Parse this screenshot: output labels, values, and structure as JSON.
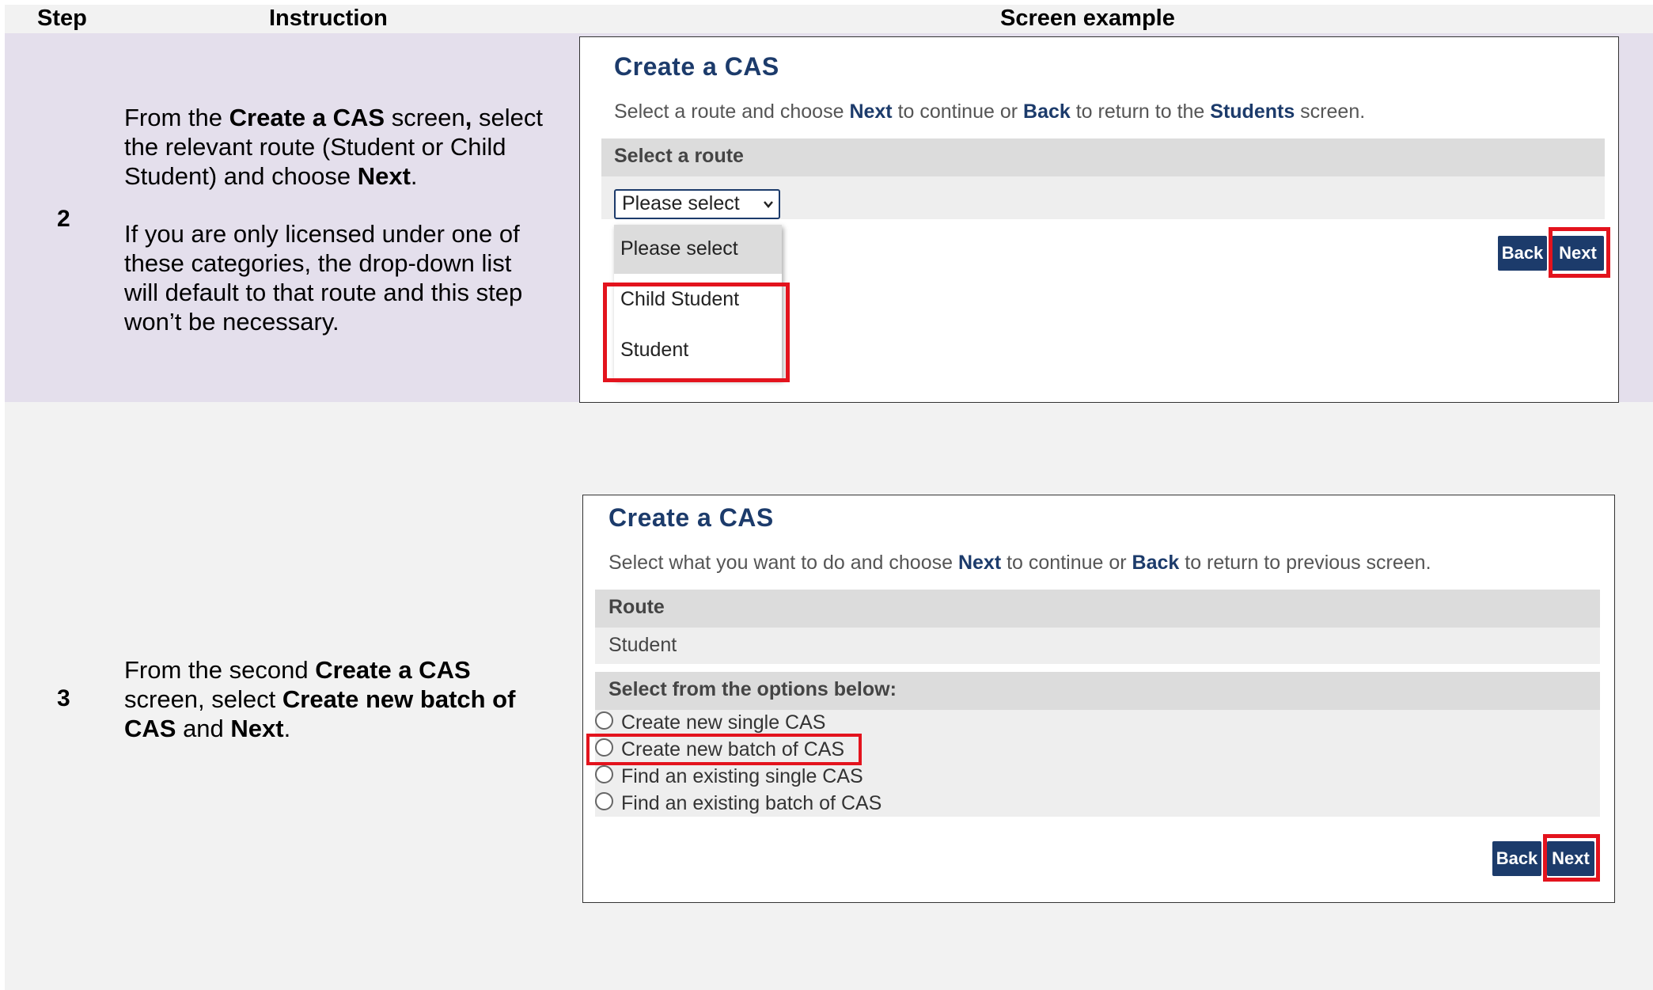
{
  "header": {
    "step": "Step",
    "instruction": "Instruction",
    "screen_example": "Screen example"
  },
  "colors": {
    "row2_bg": "#e4dfec",
    "row3_bg": "#f2f2f2",
    "header_bg": "#f2f2f2",
    "brand_navy": "#1c3b6b",
    "highlight_red": "#e3131d"
  },
  "rows": [
    {
      "step": "2",
      "para1": {
        "t1": "From the ",
        "b1": "Create a CAS",
        "t2": " screen",
        "b2": ",",
        "t3": " select the relevant route (Student or Child Student) and choose ",
        "b3": "Next",
        "t4": "."
      },
      "para2": "If you are only licensed under one of these categories, the drop-down list will default to that route and this step won’t be necessary.",
      "screen": {
        "title": "Create a CAS",
        "desc": {
          "t1": "Select a route and choose ",
          "b1": "Next",
          "t2": " to continue or ",
          "b2": "Back",
          "t3": " to return to the ",
          "b3": "Students",
          "t4": " screen."
        },
        "section_label": "Select a route",
        "select_value": "Please select",
        "options": [
          "Please select",
          "Child Student",
          "Student"
        ],
        "back": "Back",
        "next": "Next"
      }
    },
    {
      "step": "3",
      "para1": {
        "t1": "From the second ",
        "b1": "Create a CAS",
        "t2": " screen, select ",
        "b2": "Create new batch of CAS",
        "t3": " and ",
        "b3": "Next",
        "t4": "."
      },
      "screen": {
        "title": "Create a CAS",
        "desc": {
          "t1": "Select what you want to do and choose ",
          "b1": "Next",
          "t2": " to continue or ",
          "b2": "Back",
          "t3": " to return to previous screen."
        },
        "route_label": "Route",
        "route_value": "Student",
        "options_label": "Select from the options below:",
        "options": [
          "Create new single CAS",
          "Create new batch of CAS",
          "Find an existing single CAS",
          "Find an existing batch of CAS"
        ],
        "back": "Back",
        "next": "Next"
      }
    }
  ]
}
